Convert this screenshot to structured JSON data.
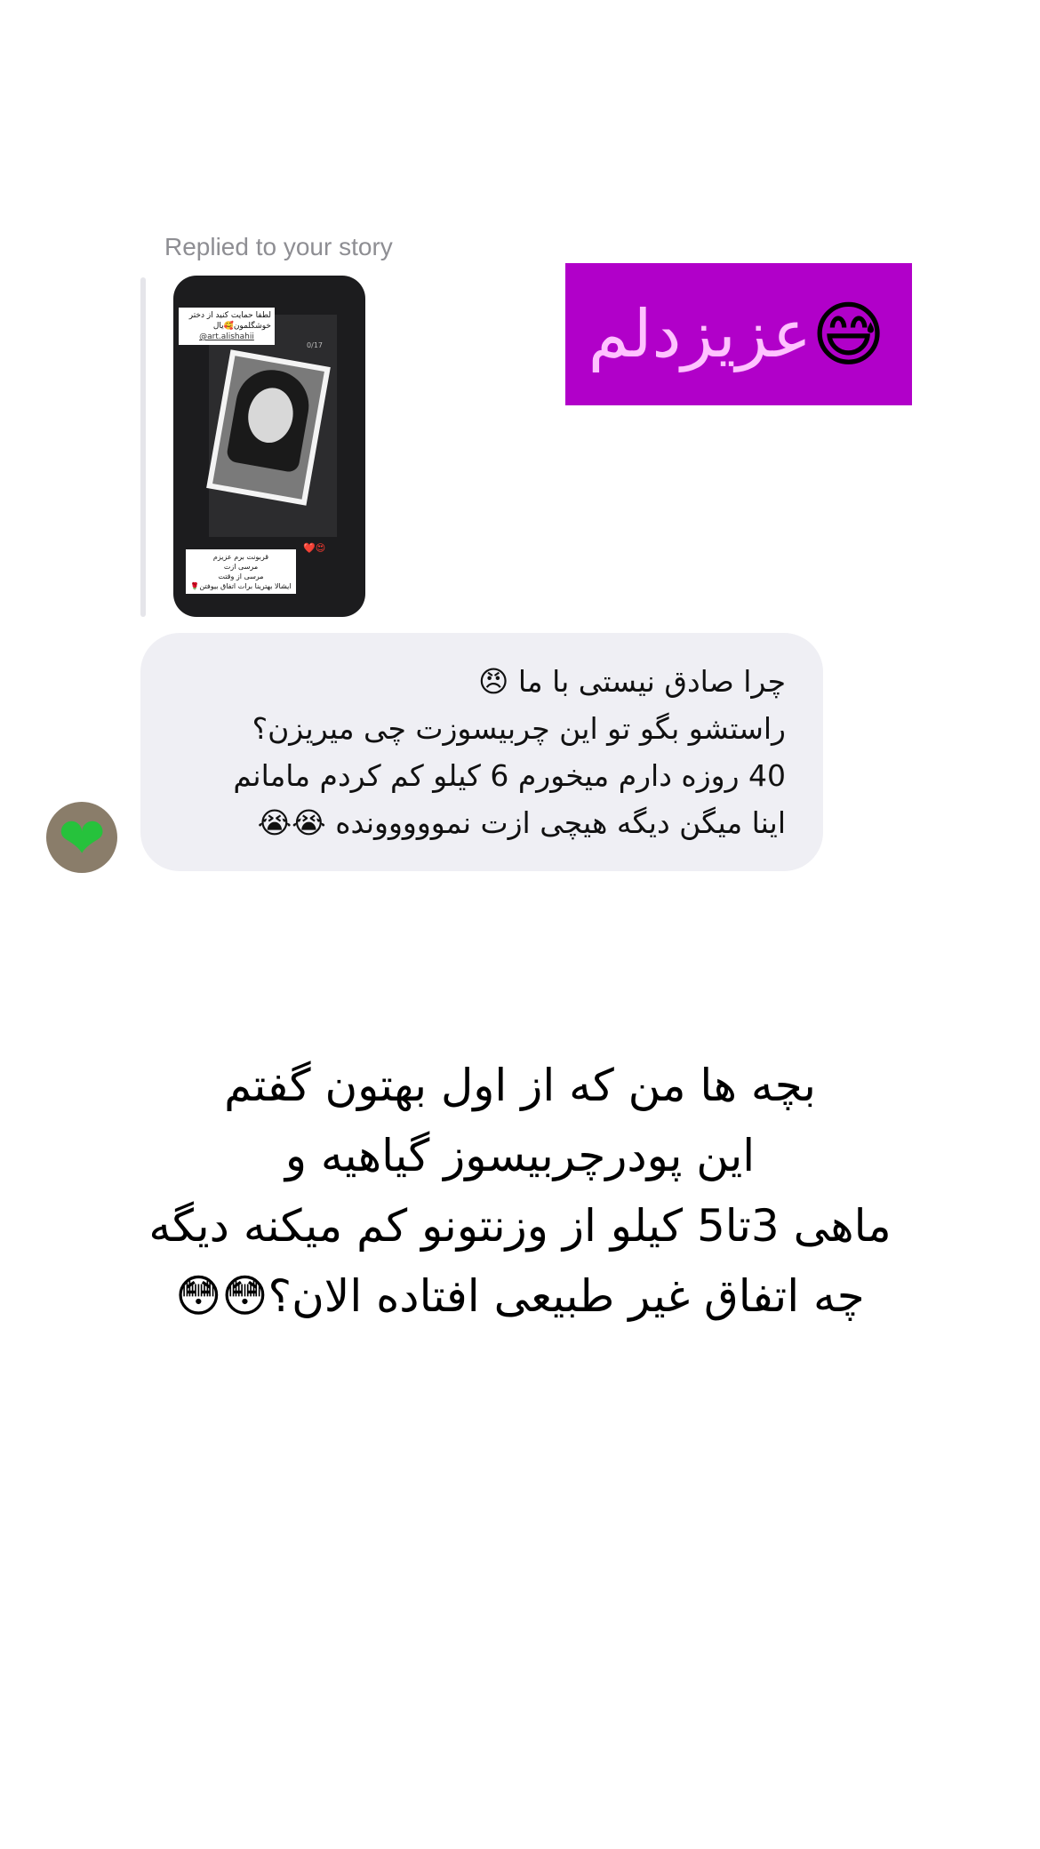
{
  "reply_header": {
    "label": "Replied to your story"
  },
  "story_thumbnail": {
    "top_caption": "لطفا حمایت کنید از دختر خوشگلمون🥰یال",
    "handle": "@art.alishahii",
    "counter": "0/17",
    "reactions": "❤️😍",
    "bottom_caption_lines": [
      "قربونت برم عزیزم",
      "مرسی ازت",
      "مرسی از وقتت",
      "ایشالا بهترینا برات اتفاق بیوفتن🌹"
    ]
  },
  "sticker": {
    "text": "عزیزدلم",
    "emoji": "😅",
    "color": "#b100c9",
    "text_color": "#ffc2ff"
  },
  "message": {
    "lines": [
      "چرا صادق نیستی با ما 😠",
      "راستشو بگو تو این چربیسوزت چی میریزن؟",
      "40 روزه دارم میخورم 6 کیلو کم کردم مامانم",
      "اینا میگن دیگه هیچی ازت نمووووونده 😭😭"
    ],
    "bubble_color": "#efeff4"
  },
  "avatar": {
    "icon": "green-heart"
  },
  "caption": {
    "lines": [
      "بچه ها من که از اول بهتون گفتم",
      "این پودرچربیسوز گیاهیه و",
      "ماهی 3تا5 کیلو از وزنتونو کم میکنه دیگه",
      "چه اتفاق غیر طبیعی افتاده الان؟😳😳"
    ]
  }
}
